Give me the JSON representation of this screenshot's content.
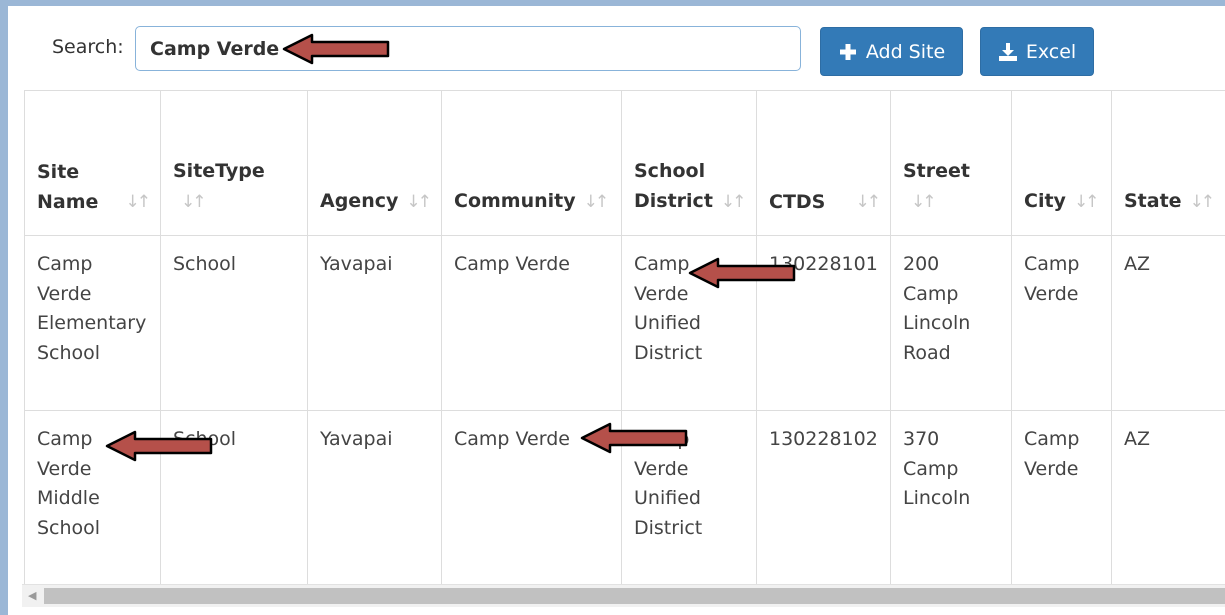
{
  "search": {
    "label": "Search:",
    "value": "Camp Verde"
  },
  "toolbar": {
    "add_site_label": "Add Site",
    "excel_label": "Excel",
    "accent_color": "#337ab7"
  },
  "table": {
    "columns": [
      "Site Name",
      "SiteType",
      "Agency",
      "Community",
      "School District",
      "CTDS",
      "Street",
      "City",
      "State"
    ],
    "rows": [
      [
        "Camp Verde Elementary School",
        "School",
        "Yavapai",
        "Camp Verde",
        "Camp Verde Unified District",
        "130228101",
        "200 Camp Lincoln Road",
        "Camp Verde",
        "AZ"
      ],
      [
        "Camp Verde Middle School",
        "School",
        "Yavapai",
        "Camp Verde",
        "Camp Verde Unified District",
        "130228102",
        "370 Camp Lincoln",
        "Camp Verde",
        "AZ"
      ]
    ]
  },
  "annotations": {
    "arrow_color": "#b5504a",
    "icon": "arrow-left"
  }
}
